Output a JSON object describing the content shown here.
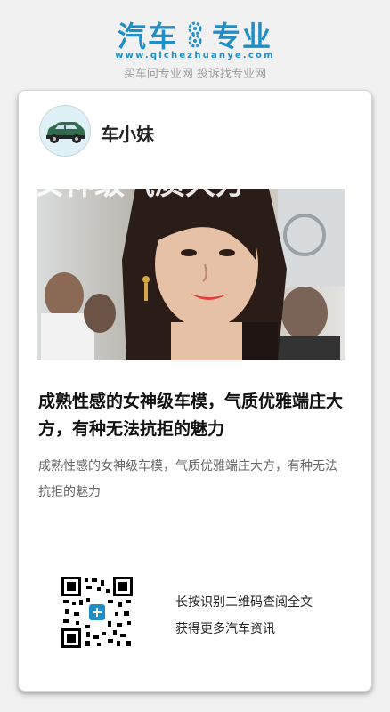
{
  "header": {
    "logo_left": "汽车",
    "logo_right": "专业",
    "domain": "www.qichezhuanye.com",
    "slogan": "买车问专业网 投诉找专业网"
  },
  "card": {
    "author": "车小妹",
    "photo_overlay_text": "女神级气质大方",
    "title": "成熟性感的女神级车模，气质优雅端庄大方，有种无法抗拒的魅力",
    "summary": "成熟性感的女神级车模，气质优雅端庄大方，有种无法抗拒的魅力",
    "qr_line1": "长按识别二维码查阅全文",
    "qr_line2": "获得更多汽车资讯"
  },
  "colors": {
    "brand": "#1f8fc8",
    "background": "#f1f1f1"
  },
  "icons": {
    "avatar": "car-icon",
    "logo_mark": "gear-icon",
    "qr": "qr-code-icon"
  }
}
